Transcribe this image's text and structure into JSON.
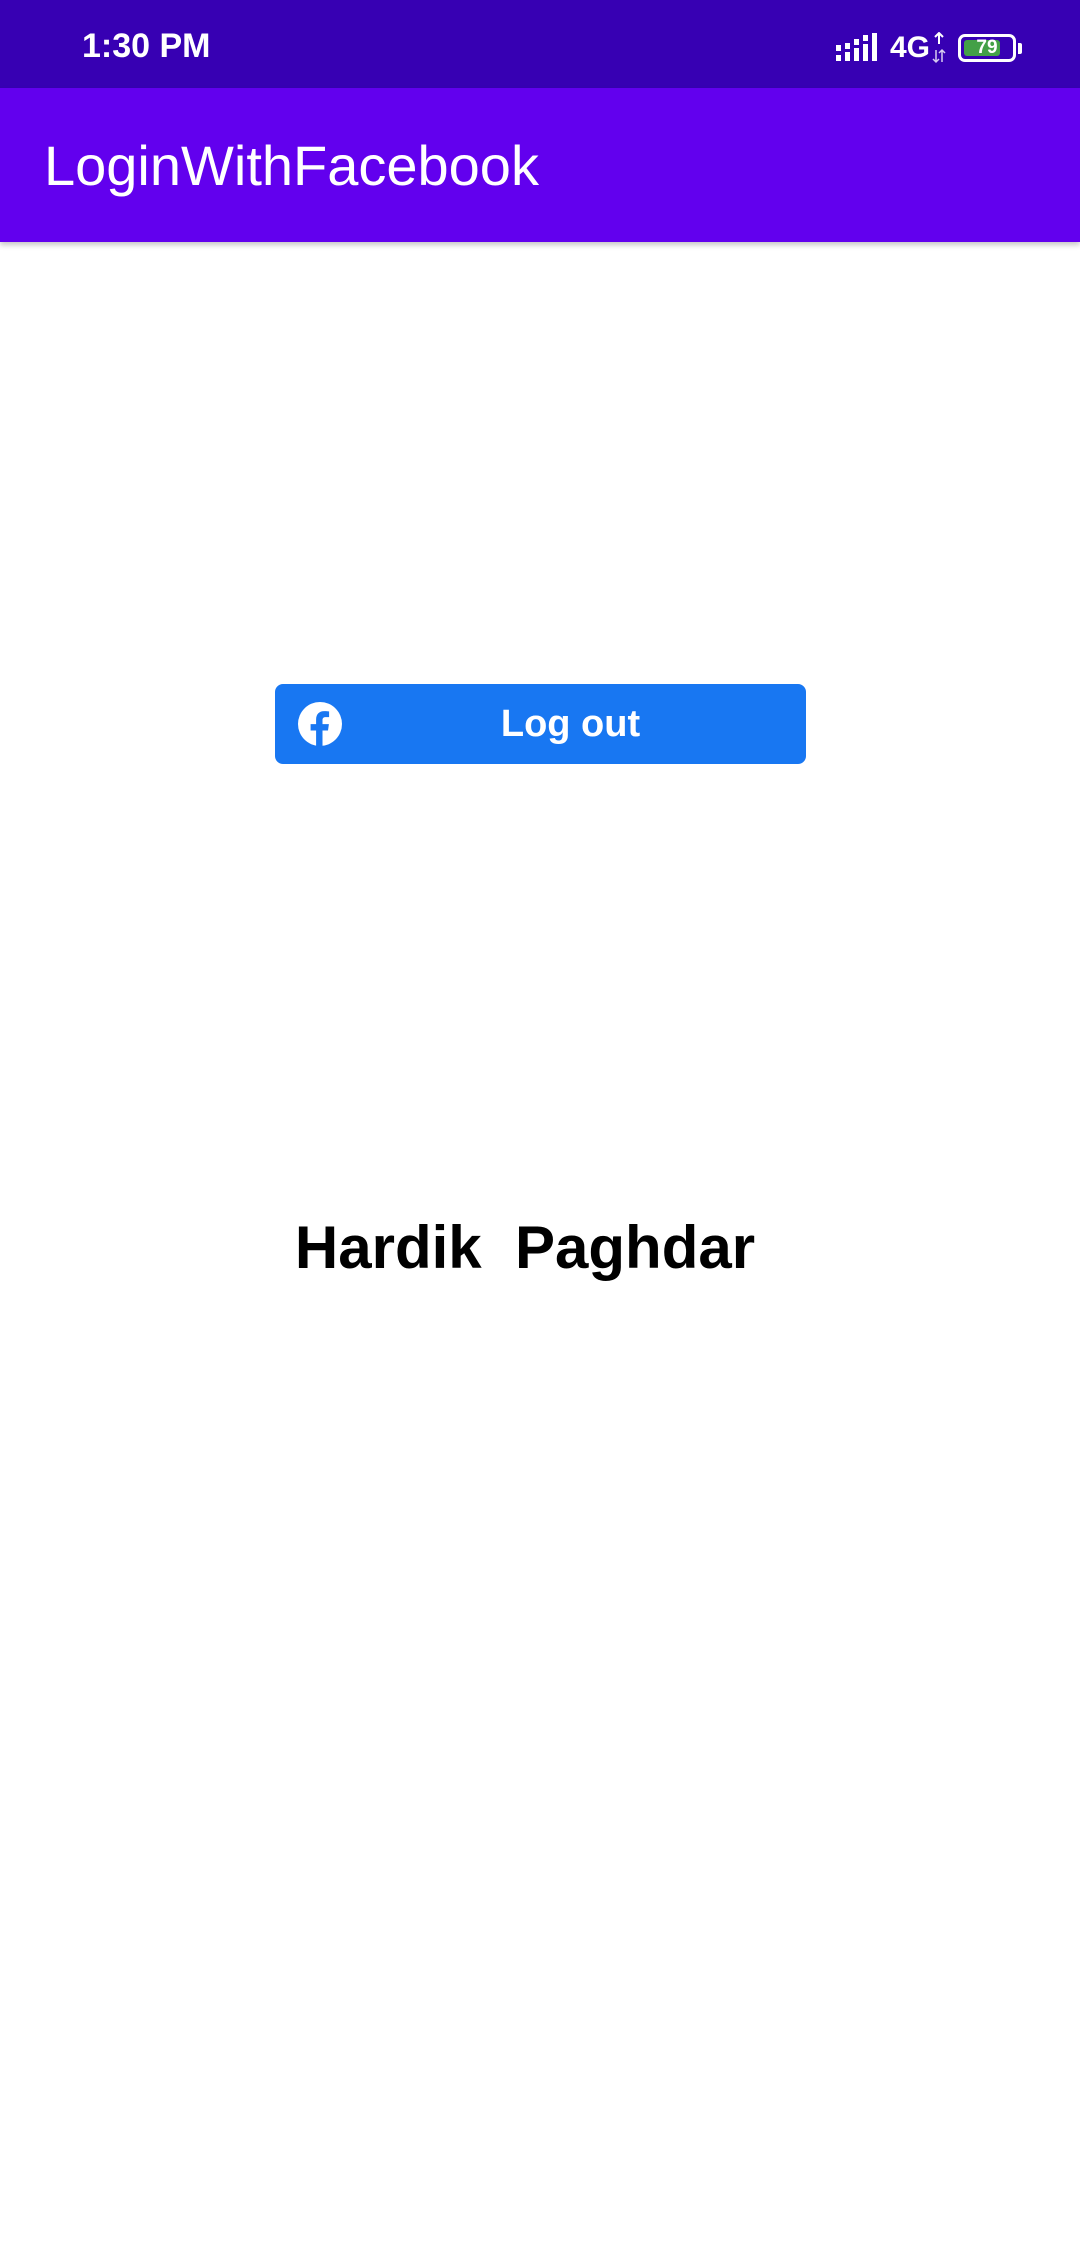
{
  "status_bar": {
    "time": "1:30 PM",
    "network": "4G",
    "battery_level": "79",
    "battery_fraction": 0.79,
    "icons": [
      "signal-icon",
      "network-arrows-icon",
      "battery-icon"
    ]
  },
  "app_bar": {
    "title": "LoginWithFacebook"
  },
  "login_button": {
    "label": "Log out",
    "icon": "facebook-icon"
  },
  "profile": {
    "name": "Hardik  Paghdar"
  },
  "colors": {
    "status_bar": "#3700b3",
    "app_bar": "#6200ee",
    "facebook_blue": "#1877f2",
    "battery_green": "#43a047"
  }
}
